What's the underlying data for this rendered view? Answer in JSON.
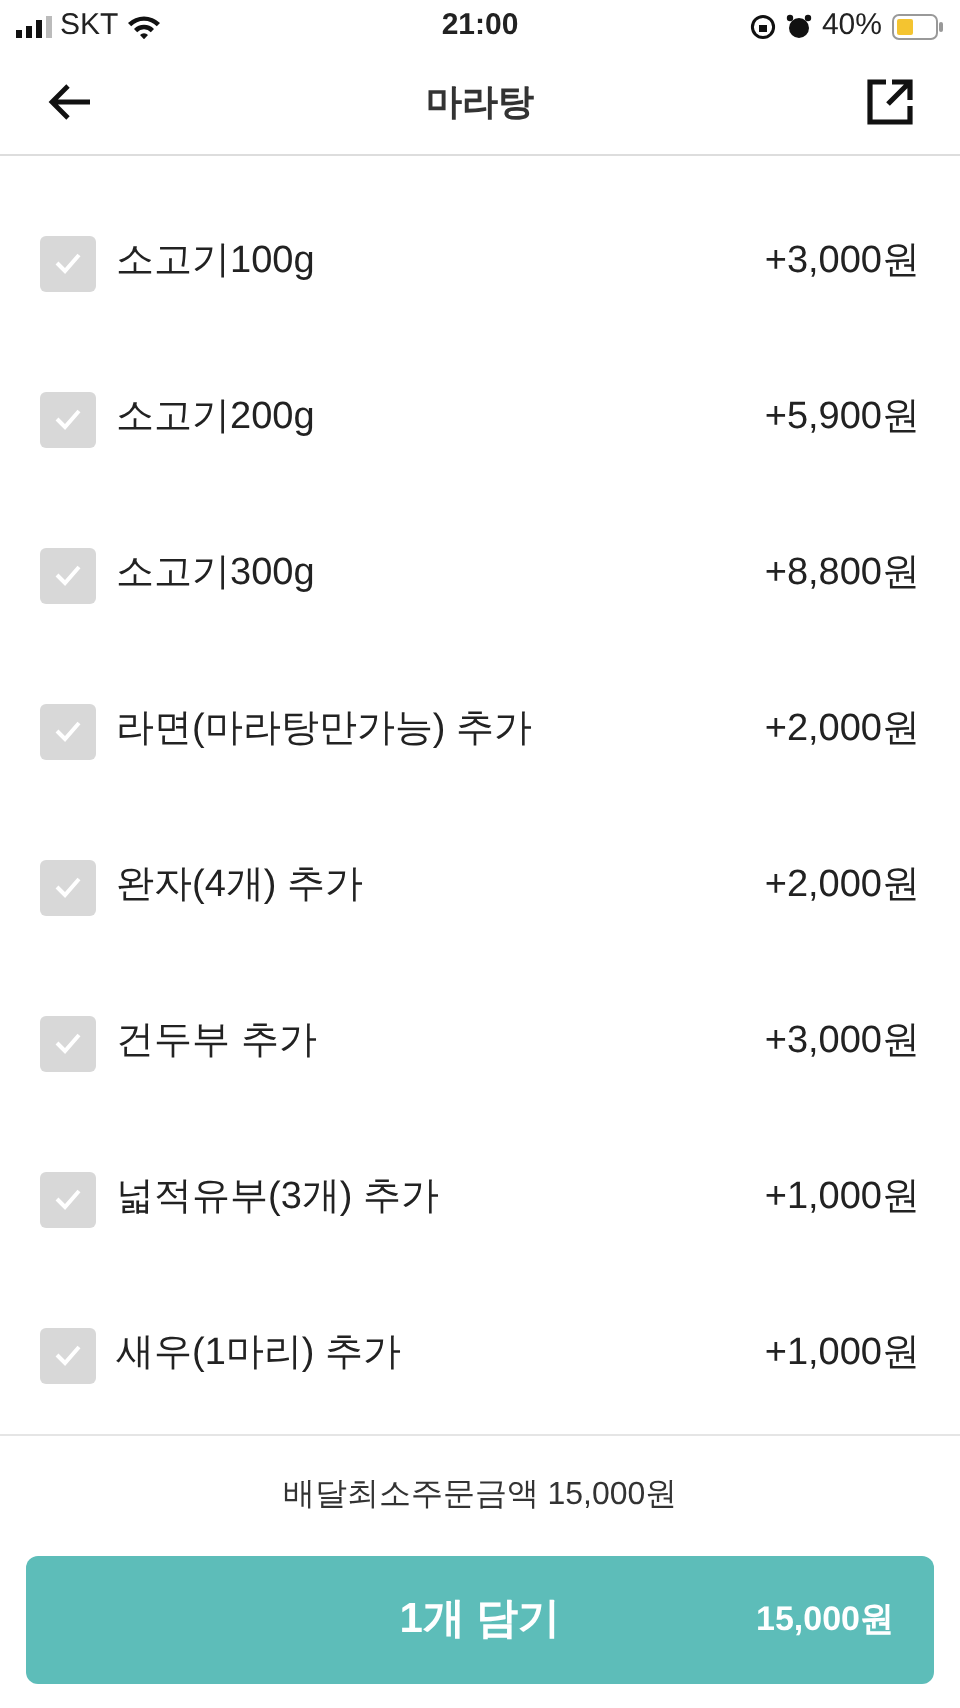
{
  "status_bar": {
    "carrier": "SKT",
    "time": "21:00",
    "battery": "40%"
  },
  "header": {
    "title": "마라탕"
  },
  "options": [
    {
      "label": "소고기100g",
      "price": "+3,000원",
      "checked": false
    },
    {
      "label": "소고기200g",
      "price": "+5,900원",
      "checked": false
    },
    {
      "label": "소고기300g",
      "price": "+8,800원",
      "checked": false
    },
    {
      "label": "라면(마라탕만가능) 추가",
      "price": "+2,000원",
      "checked": false
    },
    {
      "label": "완자(4개) 추가",
      "price": "+2,000원",
      "checked": false
    },
    {
      "label": "건두부 추가",
      "price": "+3,000원",
      "checked": false
    },
    {
      "label": "넓적유부(3개) 추가",
      "price": "+1,000원",
      "checked": false
    },
    {
      "label": "새우(1마리) 추가",
      "price": "+1,000원",
      "checked": false
    }
  ],
  "footer": {
    "minimum_order": "배달최소주문금액 15,000원",
    "add_button": {
      "label": "1개 담기",
      "price": "15,000원"
    }
  }
}
